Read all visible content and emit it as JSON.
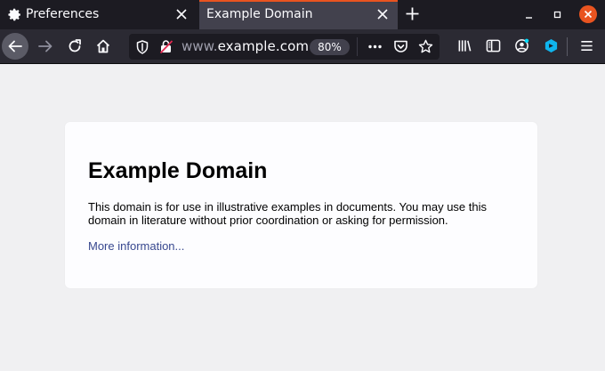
{
  "tabs": [
    {
      "title": "Preferences",
      "icon": "gear-icon",
      "active": false
    },
    {
      "title": "Example Domain",
      "active": true
    }
  ],
  "window": {
    "controls": [
      "minimize",
      "restore",
      "close"
    ],
    "accent": "#e95420"
  },
  "urlbar": {
    "url_prefix": "www.",
    "url_host": "example.com",
    "zoom": "80%"
  },
  "page": {
    "heading": "Example Domain",
    "body": "This domain is for use in illustrative examples in documents. You may use this domain in literature without prior coordination or asking for permission.",
    "link": "More information...",
    "link_color": "#38488f"
  },
  "colors": {
    "tabstrip": "#1c1b22",
    "active_tab": "#42414d",
    "toolbar": "#2b2a33",
    "page_bg": "#f0f0f2",
    "card_bg": "#fdfdff"
  }
}
